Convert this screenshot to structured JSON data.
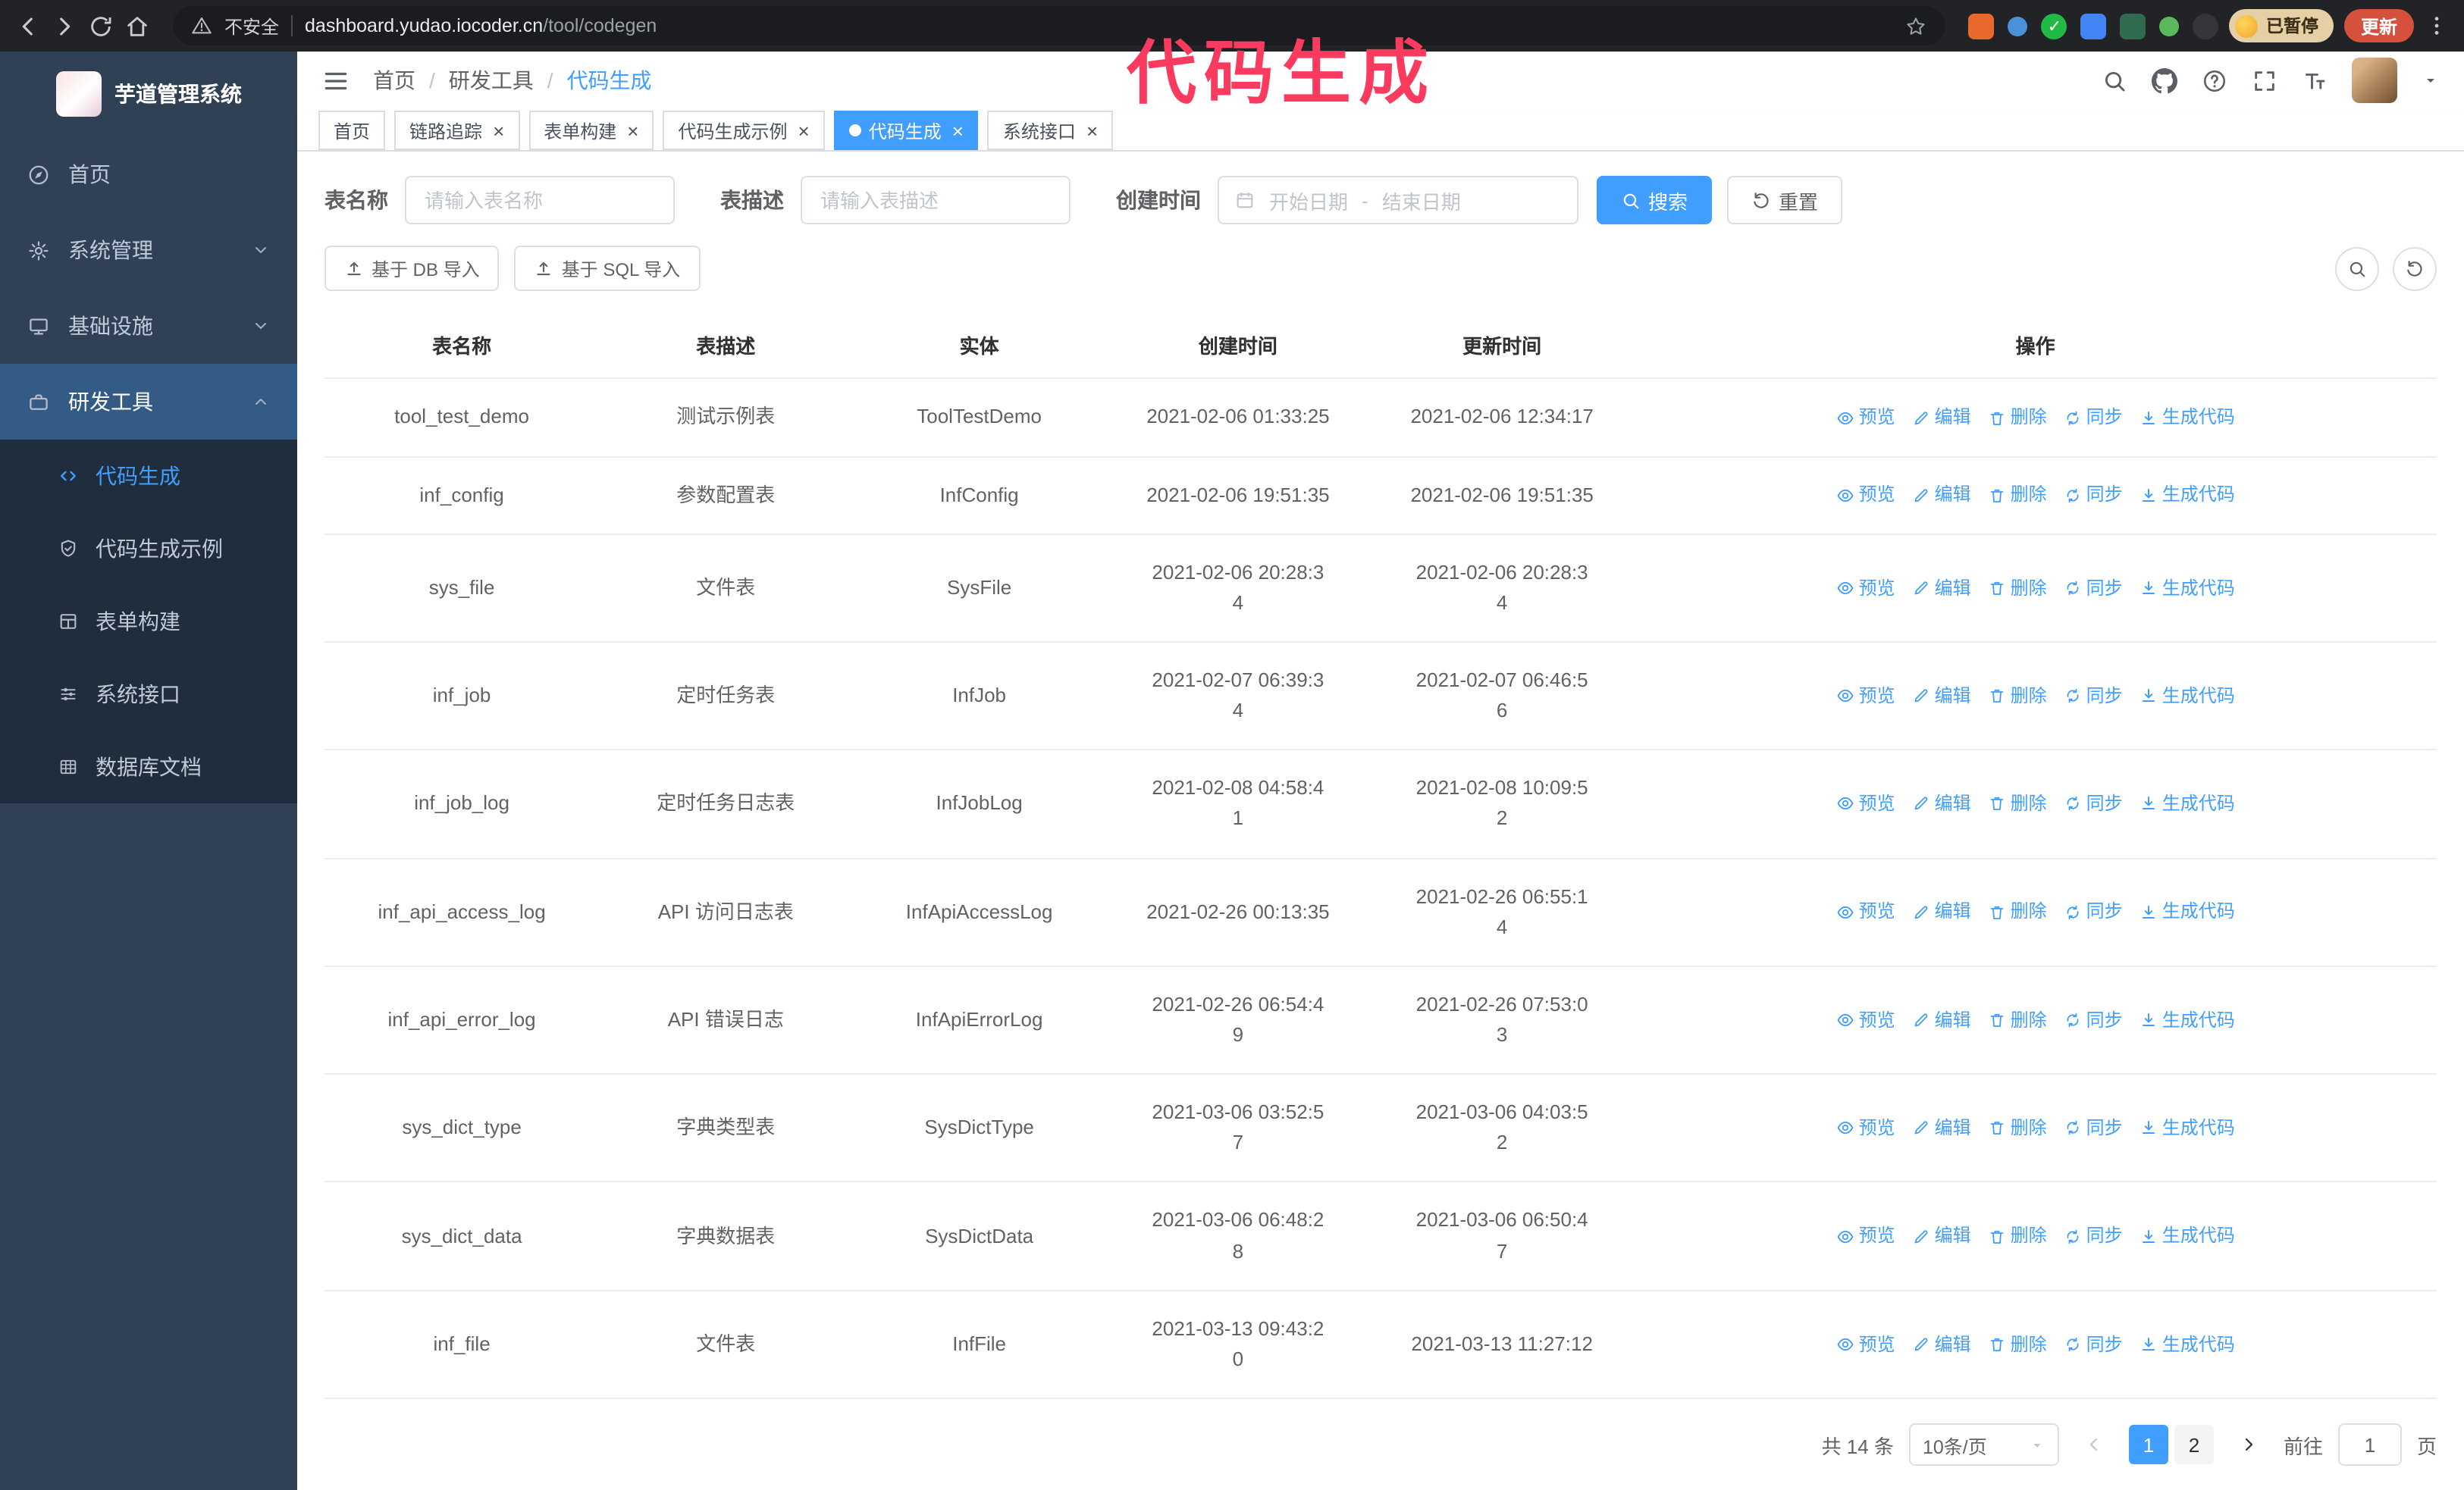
{
  "colors": {
    "accent": "#409eff",
    "sidebar_bg": "#304156",
    "submenu_bg": "#1f2d3d",
    "annotation": "#fb3a5f",
    "update_button": "#d6503e",
    "paused_badge": "#e5cfa5"
  },
  "annotation": {
    "text": "代码生成"
  },
  "browser": {
    "security_label": "不安全",
    "url_domain": "dashboard.yudao.iocoder.cn",
    "url_path": "/tool/codegen",
    "paused_badge": "已暂停",
    "update_label": "更新"
  },
  "sidebar": {
    "logo_title": "芋道管理系统",
    "items": [
      {
        "label": "首页"
      },
      {
        "label": "系统管理"
      },
      {
        "label": "基础设施"
      },
      {
        "label": "研发工具"
      }
    ],
    "sub_items": [
      {
        "label": "代码生成",
        "active": true
      },
      {
        "label": "代码生成示例"
      },
      {
        "label": "表单构建"
      },
      {
        "label": "系统接口"
      },
      {
        "label": "数据库文档"
      }
    ]
  },
  "header": {
    "breadcrumb": [
      "首页",
      "研发工具",
      "代码生成"
    ],
    "header_icons": [
      "search",
      "github",
      "question",
      "fullscreen",
      "font-size",
      "avatar"
    ]
  },
  "tabs": [
    {
      "label": "首页",
      "closable": false,
      "active": false
    },
    {
      "label": "链路追踪",
      "closable": true,
      "active": false
    },
    {
      "label": "表单构建",
      "closable": true,
      "active": false
    },
    {
      "label": "代码生成示例",
      "closable": true,
      "active": false
    },
    {
      "label": "代码生成",
      "closable": true,
      "active": true
    },
    {
      "label": "系统接口",
      "closable": true,
      "active": false
    }
  ],
  "filter": {
    "name_label": "表名称",
    "name_placeholder": "请输入表名称",
    "desc_label": "表描述",
    "desc_placeholder": "请输入表描述",
    "time_label": "创建时间",
    "start_placeholder": "开始日期",
    "range_separator": "-",
    "end_placeholder": "结束日期",
    "search_label": "搜索",
    "reset_label": "重置"
  },
  "toolbar": {
    "import_db_label": "基于 DB 导入",
    "import_sql_label": "基于 SQL 导入"
  },
  "table": {
    "columns": [
      "表名称",
      "表描述",
      "实体",
      "创建时间",
      "更新时间",
      "操作"
    ],
    "actions": [
      "预览",
      "编辑",
      "删除",
      "同步",
      "生成代码"
    ],
    "rows": [
      {
        "name": "tool_test_demo",
        "desc": "测试示例表",
        "entity": "ToolTestDemo",
        "created": "2021-02-06 01:33:25",
        "updated": "2021-02-06 12:34:17"
      },
      {
        "name": "inf_config",
        "desc": "参数配置表",
        "entity": "InfConfig",
        "created": "2021-02-06 19:51:35",
        "updated": "2021-02-06 19:51:35"
      },
      {
        "name": "sys_file",
        "desc": "文件表",
        "entity": "SysFile",
        "created": "2021-02-06 20:28:3\n4",
        "updated": "2021-02-06 20:28:3\n4"
      },
      {
        "name": "inf_job",
        "desc": "定时任务表",
        "entity": "InfJob",
        "created": "2021-02-07 06:39:3\n4",
        "updated": "2021-02-07 06:46:5\n6"
      },
      {
        "name": "inf_job_log",
        "desc": "定时任务日志表",
        "entity": "InfJobLog",
        "created": "2021-02-08 04:58:4\n1",
        "updated": "2021-02-08 10:09:5\n2"
      },
      {
        "name": "inf_api_access_log",
        "desc": "API 访问日志表",
        "entity": "InfApiAccessLog",
        "created": "2021-02-26 00:13:35",
        "updated": "2021-02-26 06:55:1\n4"
      },
      {
        "name": "inf_api_error_log",
        "desc": "API 错误日志",
        "entity": "InfApiErrorLog",
        "created": "2021-02-26 06:54:4\n9",
        "updated": "2021-02-26 07:53:0\n3"
      },
      {
        "name": "sys_dict_type",
        "desc": "字典类型表",
        "entity": "SysDictType",
        "created": "2021-03-06 03:52:5\n7",
        "updated": "2021-03-06 04:03:5\n2"
      },
      {
        "name": "sys_dict_data",
        "desc": "字典数据表",
        "entity": "SysDictData",
        "created": "2021-03-06 06:48:2\n8",
        "updated": "2021-03-06 06:50:4\n7"
      },
      {
        "name": "inf_file",
        "desc": "文件表",
        "entity": "InfFile",
        "created": "2021-03-13 09:43:2\n0",
        "updated": "2021-03-13 11:27:12"
      }
    ]
  },
  "pagination": {
    "total_text": "共 14 条",
    "page_size_text": "10条/页",
    "pages": [
      {
        "label": "1",
        "active": true
      },
      {
        "label": "2",
        "active": false
      }
    ],
    "goto_label": "前往",
    "goto_value": "1",
    "goto_suffix": "页"
  }
}
